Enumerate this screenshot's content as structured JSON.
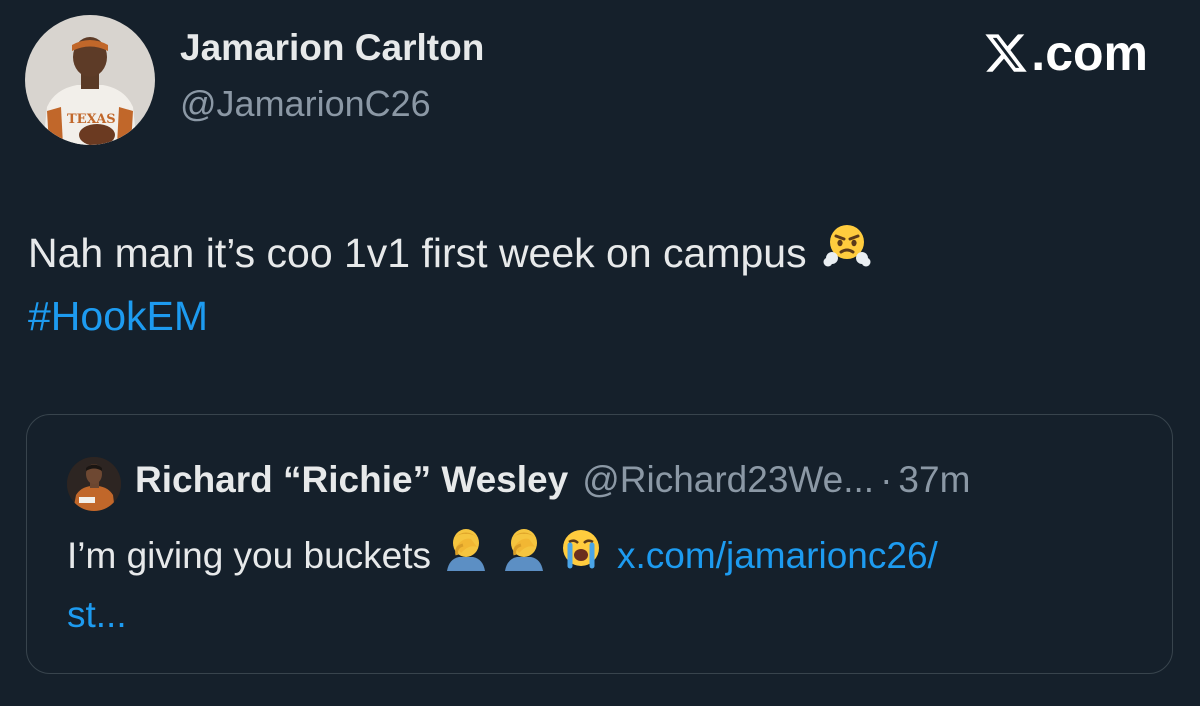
{
  "tweet": {
    "author_name": "Jamarion Carlton",
    "author_handle": "@JamarionC26",
    "avatar_jersey_text": "TEXAS",
    "text": "Nah man it’s coo 1v1 first week on campus",
    "hashtag": "#HookEM",
    "emoji": "face-with-steam-from-nose"
  },
  "brand": {
    "label": ".com",
    "logo": "x-logo-icon"
  },
  "quoted_tweet": {
    "author_name": "Richard “Richie” Wesley",
    "author_handle": "@Richard23We...",
    "separator": "·",
    "time": "37m",
    "text": "I’m giving you buckets",
    "link_part1": "x.com/jamarionc26/",
    "link_part2": "st...",
    "emojis": [
      "man-facepalming",
      "man-facepalming",
      "loudly-crying-face"
    ]
  },
  "colors": {
    "background": "#15202b",
    "text": "#e7e9ea",
    "muted": "#8b98a5",
    "link": "#1d9bf0",
    "border": "#38444d"
  }
}
